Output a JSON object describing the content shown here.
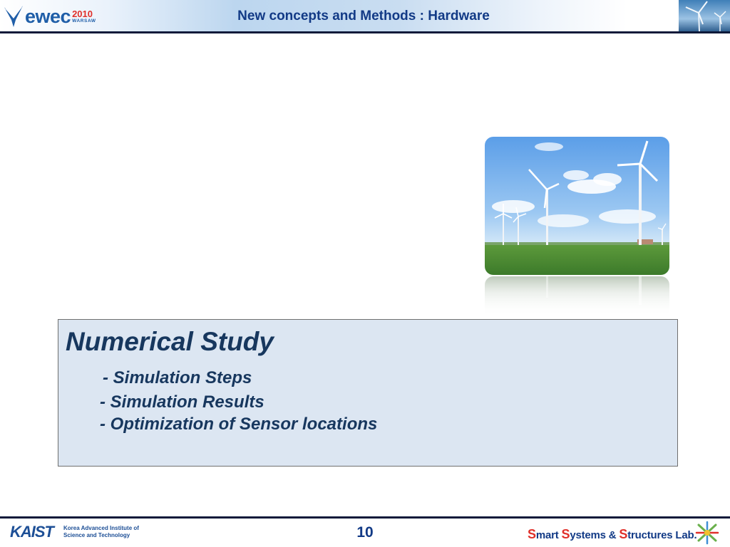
{
  "header": {
    "logo": {
      "word": "ewec",
      "year": "2010",
      "city": "WARSAW"
    },
    "title": "New concepts and Methods : Hardware"
  },
  "content": {
    "heading": "Numerical Study",
    "items": [
      "- Simulation Steps",
      "- Simulation Results",
      "- Optimization of Sensor locations"
    ]
  },
  "footer": {
    "institution_logo": {
      "word": "KAIST",
      "subtitle": "Korea Advanced Institute of Science and Technology"
    },
    "page_number": "10",
    "lab": {
      "s1": "S",
      "w1": "mart ",
      "s2": "S",
      "w2": "ystems & ",
      "s3": "S",
      "w3": "tructures Lab."
    }
  },
  "colors": {
    "title_blue": "#123a86",
    "box_fill": "#dce6f2",
    "box_text": "#17375e",
    "accent_red": "#e0302a",
    "rule": "#0d1a3a"
  },
  "icons": [
    "ewec-logo-icon",
    "turbine-corner-icon",
    "wind-turbines-photo",
    "kaist-logo",
    "lab-logo-icon"
  ]
}
